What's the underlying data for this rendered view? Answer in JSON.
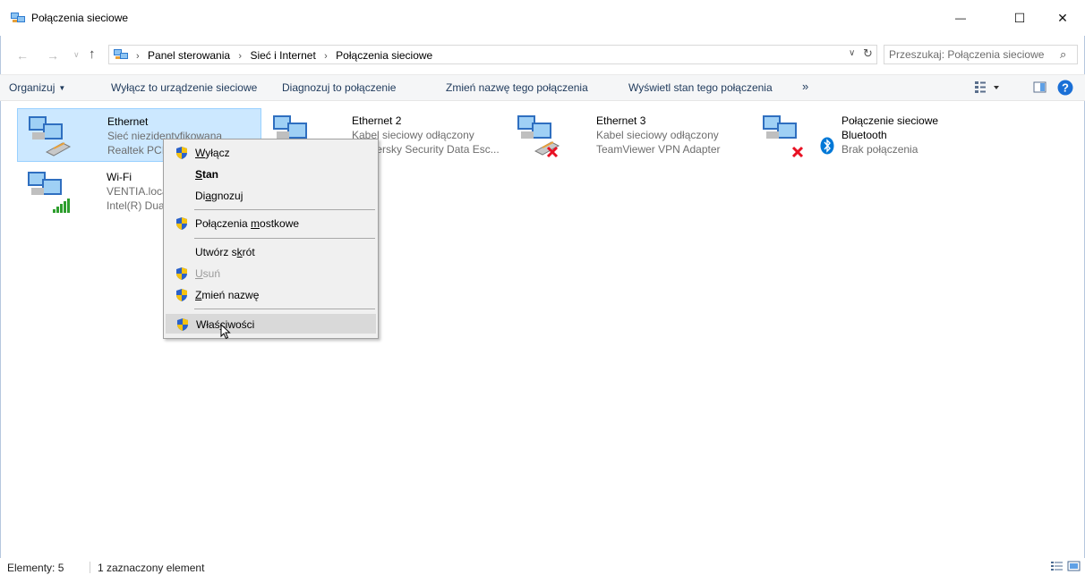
{
  "window": {
    "title": "Połączenia sieciowe",
    "minimize": "—",
    "maximize": "☐",
    "close": "✕"
  },
  "nav": {
    "back": "←",
    "forward": "→",
    "recent": "∨",
    "up": "↑"
  },
  "address": {
    "crumbs": [
      "Panel sterowania",
      "Sieć i Internet",
      "Połączenia sieciowe"
    ],
    "separator": "›",
    "dropdown": "∨",
    "refresh": "↻"
  },
  "search": {
    "placeholder": "Przeszukaj: Połączenia sieciowe",
    "icon": "⌕"
  },
  "commands": {
    "organize": "Organizuj",
    "disable": "Wyłącz to urządzenie sieciowe",
    "diagnose": "Diagnozuj to połączenie",
    "rename": "Zmień nazwę tego połączenia",
    "status": "Wyświetl stan tego połączenia",
    "more": "»"
  },
  "items": [
    {
      "name": "Ethernet",
      "line2": "Sieć niezidentyfikowana",
      "line3": "Realtek PCIe GbE Family Controller",
      "state": "connected"
    },
    {
      "name": "Ethernet 2",
      "line2": "Kabel sieciowy odłączony",
      "line3": "Kaspersky Security Data Esc...",
      "state": "unplugged"
    },
    {
      "name": "Ethernet 3",
      "line2": "Kabel sieciowy odłączony",
      "line3": "TeamViewer VPN Adapter",
      "state": "disconnected"
    },
    {
      "name": "Połączenie sieciowe",
      "line2": "Bluetooth",
      "line3": "Brak połączenia",
      "state": "bluetooth"
    },
    {
      "name": "Wi-Fi",
      "line2": "VENTIA.local",
      "line3": "Intel(R) Dual Band Wireless-AC",
      "state": "wifi"
    }
  ],
  "context_menu": {
    "disable": {
      "pre": "",
      "u": "W",
      "post": "yłącz"
    },
    "status": {
      "pre": "",
      "u": "S",
      "post": "tan"
    },
    "diagnose": {
      "pre": "Di",
      "u": "a",
      "post": "gnozuj"
    },
    "bridge": {
      "pre": "Połączenia ",
      "u": "m",
      "post": "ostkowe"
    },
    "shortcut": {
      "pre": "Utwórz s",
      "u": "k",
      "post": "rót"
    },
    "delete": {
      "pre": "",
      "u": "U",
      "post": "suń"
    },
    "rename": {
      "pre": "",
      "u": "Z",
      "post": "mień nazwę"
    },
    "properties": {
      "pre": "Właś",
      "u": "c",
      "post": "iwości"
    }
  },
  "statusbar": {
    "count": "Elementy: 5",
    "selection": "1 zaznaczony element"
  },
  "colors": {
    "selection_bg": "#cce8ff",
    "selection_border": "#99d1ff",
    "command_text": "#1e395b",
    "help_blue": "#1a6fd6",
    "error_red": "#e81123",
    "bluetooth_blue": "#0078d7"
  }
}
